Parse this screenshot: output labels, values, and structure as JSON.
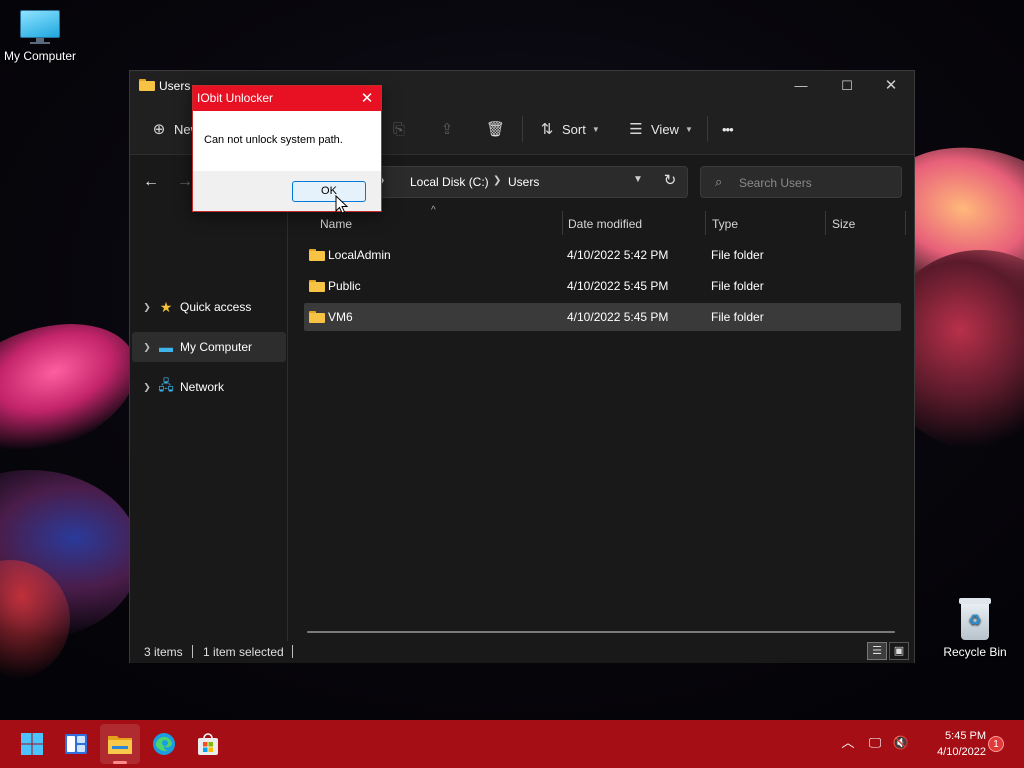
{
  "desktop": {
    "icons": [
      {
        "label": "My Computer",
        "icon": "monitor-icon"
      },
      {
        "label": "Recycle Bin",
        "icon": "recycle-bin-icon"
      }
    ]
  },
  "explorer": {
    "title": "Users",
    "window_controls": {
      "minimize": "—",
      "maximize": "☐",
      "close": "✕"
    },
    "toolbar": {
      "new_label": "New",
      "sort_label": "Sort",
      "view_label": "View",
      "more_label": "•••"
    },
    "address": {
      "crumbs": [
        "er",
        "Local Disk (C:)",
        "Users"
      ]
    },
    "search": {
      "placeholder": "Search Users"
    },
    "nav": [
      {
        "label": "Quick access",
        "icon": "star-icon"
      },
      {
        "label": "My Computer",
        "icon": "monitor-icon",
        "selected": true
      },
      {
        "label": "Network",
        "icon": "network-icon"
      }
    ],
    "columns": [
      "Name",
      "Date modified",
      "Type",
      "Size"
    ],
    "files": [
      {
        "name": "LocalAdmin",
        "date": "4/10/2022 5:42 PM",
        "type": "File folder"
      },
      {
        "name": "Public",
        "date": "4/10/2022 5:45 PM",
        "type": "File folder"
      },
      {
        "name": "VM6",
        "date": "4/10/2022 5:45 PM",
        "type": "File folder",
        "selected": true
      }
    ],
    "status": {
      "count": "3 items",
      "selection": "1 item selected"
    }
  },
  "dialog": {
    "title": "IObit Unlocker",
    "message": "Can not unlock system path.",
    "ok_label": "OK"
  },
  "taskbar": {
    "apps": [
      "start-icon",
      "widgets-icon",
      "file-explorer-icon",
      "edge-icon",
      "store-icon"
    ],
    "clock": {
      "time": "5:45 PM",
      "date": "4/10/2022"
    },
    "notifications": "1"
  },
  "colors": {
    "taskbar": "#a50e14",
    "dialog_title": "#e81123",
    "folder": "#f6c344",
    "explorer_bg": "#191919"
  }
}
